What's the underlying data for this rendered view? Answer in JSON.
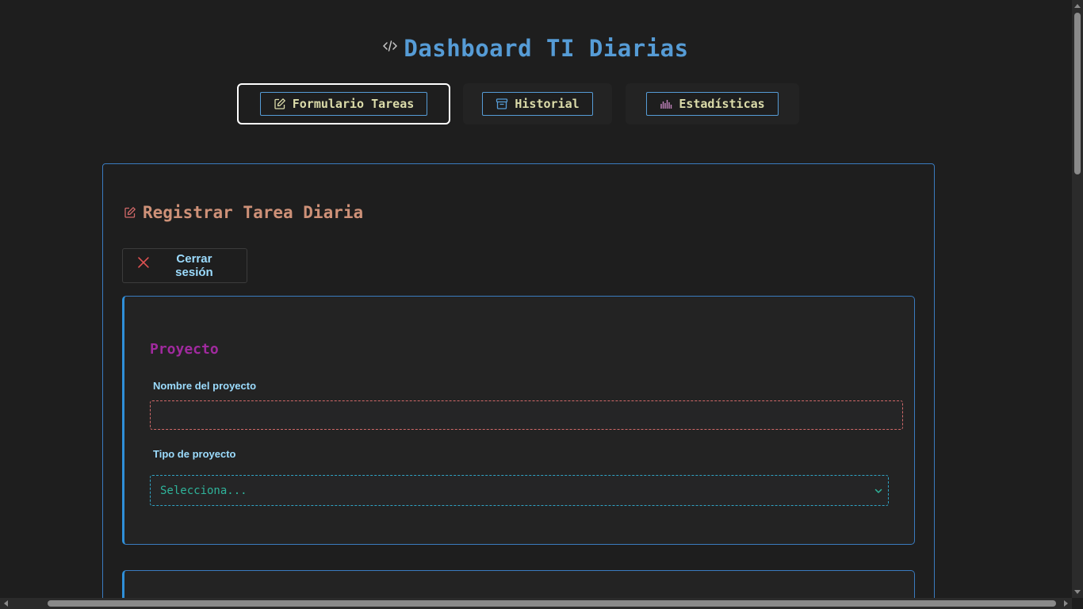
{
  "header": {
    "title": "Dashboard TI Diarias",
    "title_icon": "code-icon",
    "title_color": "#569cd6"
  },
  "tabs": [
    {
      "label": "Formulario Tareas",
      "icon": "edit-icon",
      "active": true
    },
    {
      "label": "Historial",
      "icon": "archive-icon",
      "active": false
    },
    {
      "label": "Estadísticas",
      "icon": "bar-chart-icon",
      "active": false
    }
  ],
  "form": {
    "title": "Registrar Tarea Diaria",
    "title_icon": "edit-icon",
    "logout_label": "Cerrar sesión",
    "logout_icon": "close-icon",
    "project_section": {
      "legend": "Proyecto",
      "name_label": "Nombre del proyecto",
      "name_value": "",
      "type_label": "Tipo de proyecto",
      "type_value": "Selecciona..."
    }
  },
  "colors": {
    "background": "#1e1e1e",
    "accent_blue": "#569cd6",
    "tab_text": "#dcdcaa",
    "form_title": "#ce9178",
    "legend": "#a02a9e",
    "label": "#9cdcfe",
    "name_border": "#d16969",
    "select_text": "#2fb39a",
    "close_icon": "#e05252"
  }
}
